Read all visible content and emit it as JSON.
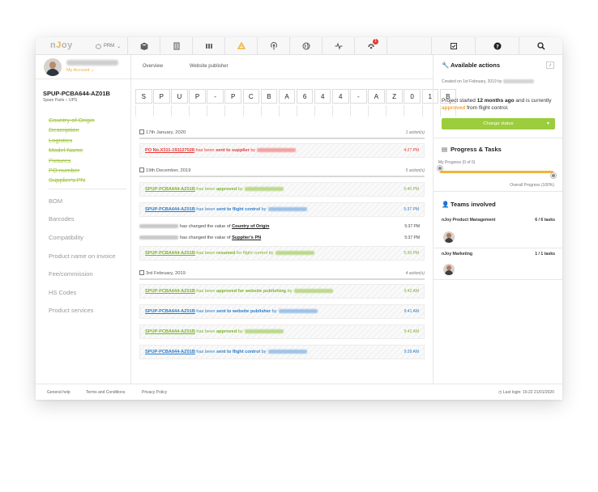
{
  "app": {
    "logo": "nJoy",
    "module": "PRM"
  },
  "user": {
    "my_account": "My Account"
  },
  "part": {
    "id": "SPUP-PCBA644-AZ01B",
    "crumb_category": "Spare Parts",
    "crumb_sub": "UPS"
  },
  "nav": {
    "completed": [
      "Country of Origin",
      "Description",
      "Logistics",
      "Model Name",
      "Pictures",
      "PO number",
      "Supplier's PN"
    ],
    "pending": [
      "BOM",
      "Barcodes",
      "Compatibility",
      "Product name on invoice",
      "Fee/commission",
      "HS Codes",
      "Product services"
    ]
  },
  "tabs": [
    "Overview",
    "Website publisher"
  ],
  "code_chars": [
    "S",
    "P",
    "U",
    "P",
    "-",
    "P",
    "C",
    "B",
    "A",
    "6",
    "4",
    "4",
    "-",
    "A",
    "Z",
    "0",
    "1",
    "B"
  ],
  "timeline": {
    "g1": {
      "date": "17th January, 2020",
      "count": "1 action(s)"
    },
    "a1": {
      "link": "PO No.X311-191127028",
      "mid": " has been ",
      "verb": "sent to supplier",
      "by": " by",
      "time": "4:27 PM"
    },
    "g2": {
      "date": "19th December, 2019",
      "count": "5 action(s)"
    },
    "a2": {
      "link": "SPUP-PCBA644-AZ01B",
      "mid": " has been ",
      "verb": "approved",
      "by": " by",
      "time": "5:40 PM"
    },
    "a3": {
      "link": "SPUP-PCBA644-AZ01B",
      "mid": " has been ",
      "verb": "sent to flight control",
      "by": " by",
      "time": "5:37 PM"
    },
    "a4": {
      "text": "has changed the value of ",
      "link": "Country of Origin",
      "time": "5:37 PM"
    },
    "a5": {
      "text": "has changed the value of ",
      "link": "Supplier's PN",
      "time": "5:37 PM"
    },
    "a6": {
      "link": "SPUP-PCBA644-AZ01B",
      "mid": " has been ",
      "verb": "resumed",
      "rest": " for flight control by",
      "time": "5:36 PM"
    },
    "g3": {
      "date": "3rd February, 2019",
      "count": "4 action(s)"
    },
    "a7": {
      "link": "SPUP-PCBA644-AZ01B",
      "mid": " has been ",
      "verb": "approved for website publishing",
      "by": " by",
      "time": "9:42 AM"
    },
    "a8": {
      "link": "SPUP-PCBA644-AZ01B",
      "mid": " has been ",
      "verb": "sent to website publisher",
      "by": " by",
      "time": "9:41 AM"
    },
    "a9": {
      "link": "SPUP-PCBA644-AZ01B",
      "mid": " has been ",
      "verb": "approved",
      "by": " by",
      "time": "9:42 AM"
    },
    "a10": {
      "link": "SPUP-PCBA644-AZ01B",
      "mid": " has been ",
      "verb": "sent to flight control",
      "by": " by",
      "time": "9:39 AM"
    }
  },
  "right": {
    "available_actions": "Available actions",
    "info": "i",
    "created": "Created on 1st February, 2019 by",
    "project_prefix": "Project started ",
    "project_duration": "12 months ago",
    "project_mid": " and is currently ",
    "project_status": "approved",
    "project_suffix": " from flight control.",
    "status_button": "Change status",
    "progress_title": "Progress & Tasks",
    "my_progress": "My Progress (0 of 0)",
    "my_progress_fraction": 0,
    "overall_progress": "Overall Progress (100%)",
    "overall_progress_fraction": 1.0,
    "teams_title": "Teams involved",
    "teams": [
      {
        "name": "nJoy Product Management",
        "tasks": "6 / 6 tasks"
      },
      {
        "name": "nJoy Marketing",
        "tasks": "1 / 1 tasks"
      }
    ]
  },
  "footer": {
    "general_help": "General help",
    "terms": "Terms and Conditions",
    "privacy": "Privacy Policy",
    "last_login": "Last login: 16:22 21/01/2020"
  },
  "colors": {
    "accent": "#f2b437",
    "approved": "#7ab32a",
    "sent": "#2a7bc8",
    "alert": "#e53935",
    "status_button": "#9ccd3c"
  }
}
